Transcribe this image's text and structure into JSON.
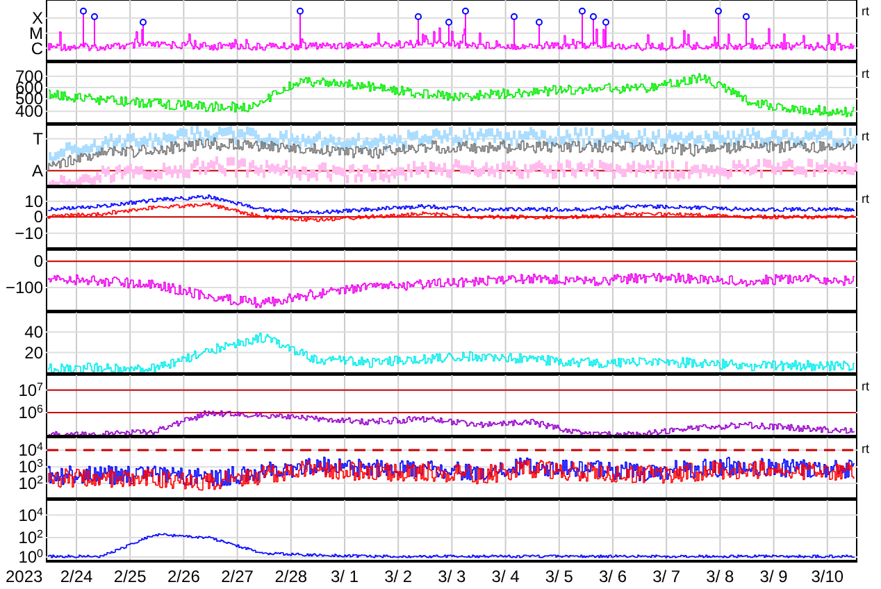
{
  "panels": [
    {
      "y_labels": [
        {
          "text": "X"
        },
        {
          "text": "M"
        },
        {
          "text": "C"
        }
      ],
      "rt": "rt",
      "traces": [
        {
          "kind": "markers",
          "color": "#ff00ff"
        }
      ]
    },
    {
      "y_labels": [
        {
          "text": "700"
        },
        {
          "text": "600"
        },
        {
          "text": "500"
        },
        {
          "text": "400"
        }
      ],
      "rt": "rt",
      "traces": [
        {
          "kind": "line",
          "color": "#00ee00"
        }
      ]
    },
    {
      "y_labels": [
        {
          "text": "T"
        },
        {
          "text": "A",
          "reference_line": true
        }
      ],
      "rt": "rt",
      "traces": [
        {
          "kind": "scatter",
          "color": "#aaddff"
        },
        {
          "kind": "scatter",
          "color": "#ffbbee"
        },
        {
          "kind": "line",
          "color": "#777777"
        }
      ]
    },
    {
      "y_labels": [
        {
          "text": "10"
        },
        {
          "text": "0",
          "reference_line": true
        },
        {
          "text": "−10"
        }
      ],
      "rt": "rt",
      "traces": [
        {
          "kind": "line",
          "color": "#0000ff"
        },
        {
          "kind": "line",
          "color": "#ff0000"
        }
      ]
    },
    {
      "y_labels": [
        {
          "text": "0",
          "reference_line": true
        },
        {
          "text": "−100"
        }
      ],
      "traces": [
        {
          "kind": "line",
          "color": "#ee00ee"
        }
      ]
    },
    {
      "y_labels": [
        {
          "text": "40"
        },
        {
          "text": "20"
        }
      ],
      "traces": [
        {
          "kind": "line",
          "color": "#00eeee"
        }
      ]
    },
    {
      "y_labels": [
        {
          "text": "10$^{7}$",
          "reference_line": true
        },
        {
          "text": "10$^{6}$",
          "reference_line": true
        }
      ],
      "rt": "rt",
      "traces": [
        {
          "kind": "line",
          "color": "#9900cc"
        }
      ]
    },
    {
      "y_labels": [
        {
          "text": "10$^{4}$",
          "reference_line": true,
          "dashed": true
        },
        {
          "text": "10$^{3}$"
        },
        {
          "text": "10$^{2}$"
        }
      ],
      "rt": "rt",
      "traces": [
        {
          "kind": "line",
          "color": "#0000ff"
        },
        {
          "kind": "line",
          "color": "#ff0000"
        }
      ]
    },
    {
      "y_labels": [
        {
          "text": "10$^{4}$"
        },
        {
          "text": "10$^{2}$"
        },
        {
          "text": "10$^{0}$"
        }
      ],
      "traces": [
        {
          "kind": "line",
          "color": "#0000ff"
        }
      ]
    }
  ],
  "x_axis": {
    "year": "2023",
    "dates": [
      "2/24",
      "2/25",
      "2/26",
      "2/27",
      "2/28",
      "3/ 1",
      "3/ 2",
      "3/ 3",
      "3/ 4",
      "3/ 5",
      "3/ 6",
      "3/ 7",
      "3/ 8",
      "3/ 9",
      "3/10"
    ]
  }
}
